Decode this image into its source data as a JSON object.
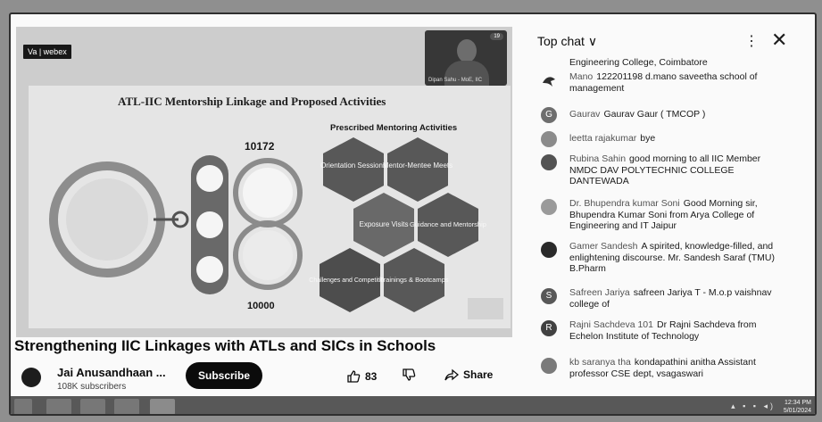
{
  "video": {
    "app_badge": "Va | webex",
    "participant_name": "Dipan Sahu - MoE, IIC",
    "participant_count": "19",
    "slide": {
      "title": "ATL-IIC Mentorship Linkage and Proposed Activities",
      "count_top": "10172",
      "count_bottom": "10000",
      "section_heading": "Prescribed Mentoring Activities",
      "activities": [
        "Orientation Sessions",
        "Mentor-Mentee Meets",
        "Exposure Visits",
        "Guidance and Mentorship",
        "Challenges and Competitions",
        "Trainings & Bootcamps"
      ]
    }
  },
  "title": "Strengthening IIC Linkages with ATLs and SICs in Schools",
  "channel": {
    "name": "Jai Anusandhaan ...",
    "subscribers": "108K subscribers",
    "subscribe_label": "Subscribe"
  },
  "actions": {
    "like_count": "83",
    "share_label": "Share"
  },
  "chat": {
    "title": "Top chat",
    "title_chevron": "∨",
    "more_glyph": "⋮",
    "close_glyph": "✕",
    "messages": [
      {
        "author": "",
        "text": "Engineering College, Coimbatore",
        "avatar": ""
      },
      {
        "author": "Mano",
        "text": "122201198 d.mano saveetha school of management",
        "avatar": ""
      },
      {
        "author": "Gaurav",
        "text": "Gaurav Gaur ( TMCOP )",
        "avatar": "G"
      },
      {
        "author": "leetta rajakumar",
        "text": "bye",
        "avatar": ""
      },
      {
        "author": "Rubina Sahin",
        "text": "good morning to all IIC Member NMDC DAV POLYTECHNIC COLLEGE DANTEWADA",
        "avatar": ""
      },
      {
        "author": "Dr. Bhupendra kumar Soni",
        "text": "Good Morning sir, Bhupendra Kumar Soni from Arya College of Engineering and IT Jaipur",
        "avatar": ""
      },
      {
        "author": "Gamer Sandesh",
        "text": "A spirited, knowledge-filled, and enlightening discourse. Mr. Sandesh Saraf (TMU) B.Pharm",
        "avatar": ""
      },
      {
        "author": "Safreen Jariya",
        "text": "safreen Jariya T - M.o.p vaishnav college of",
        "avatar": "S"
      },
      {
        "author": "Rajni Sachdeva 101",
        "text": "Dr Rajni Sachdeva from Echelon Institute of Technology",
        "avatar": "R"
      },
      {
        "author": "kb saranya tha",
        "text": "kondapathini anitha Assistant professor CSE dept, vsagaswari",
        "avatar": ""
      }
    ]
  },
  "taskbar": {
    "time": "12:34 PM",
    "date": "5/01/2024"
  }
}
